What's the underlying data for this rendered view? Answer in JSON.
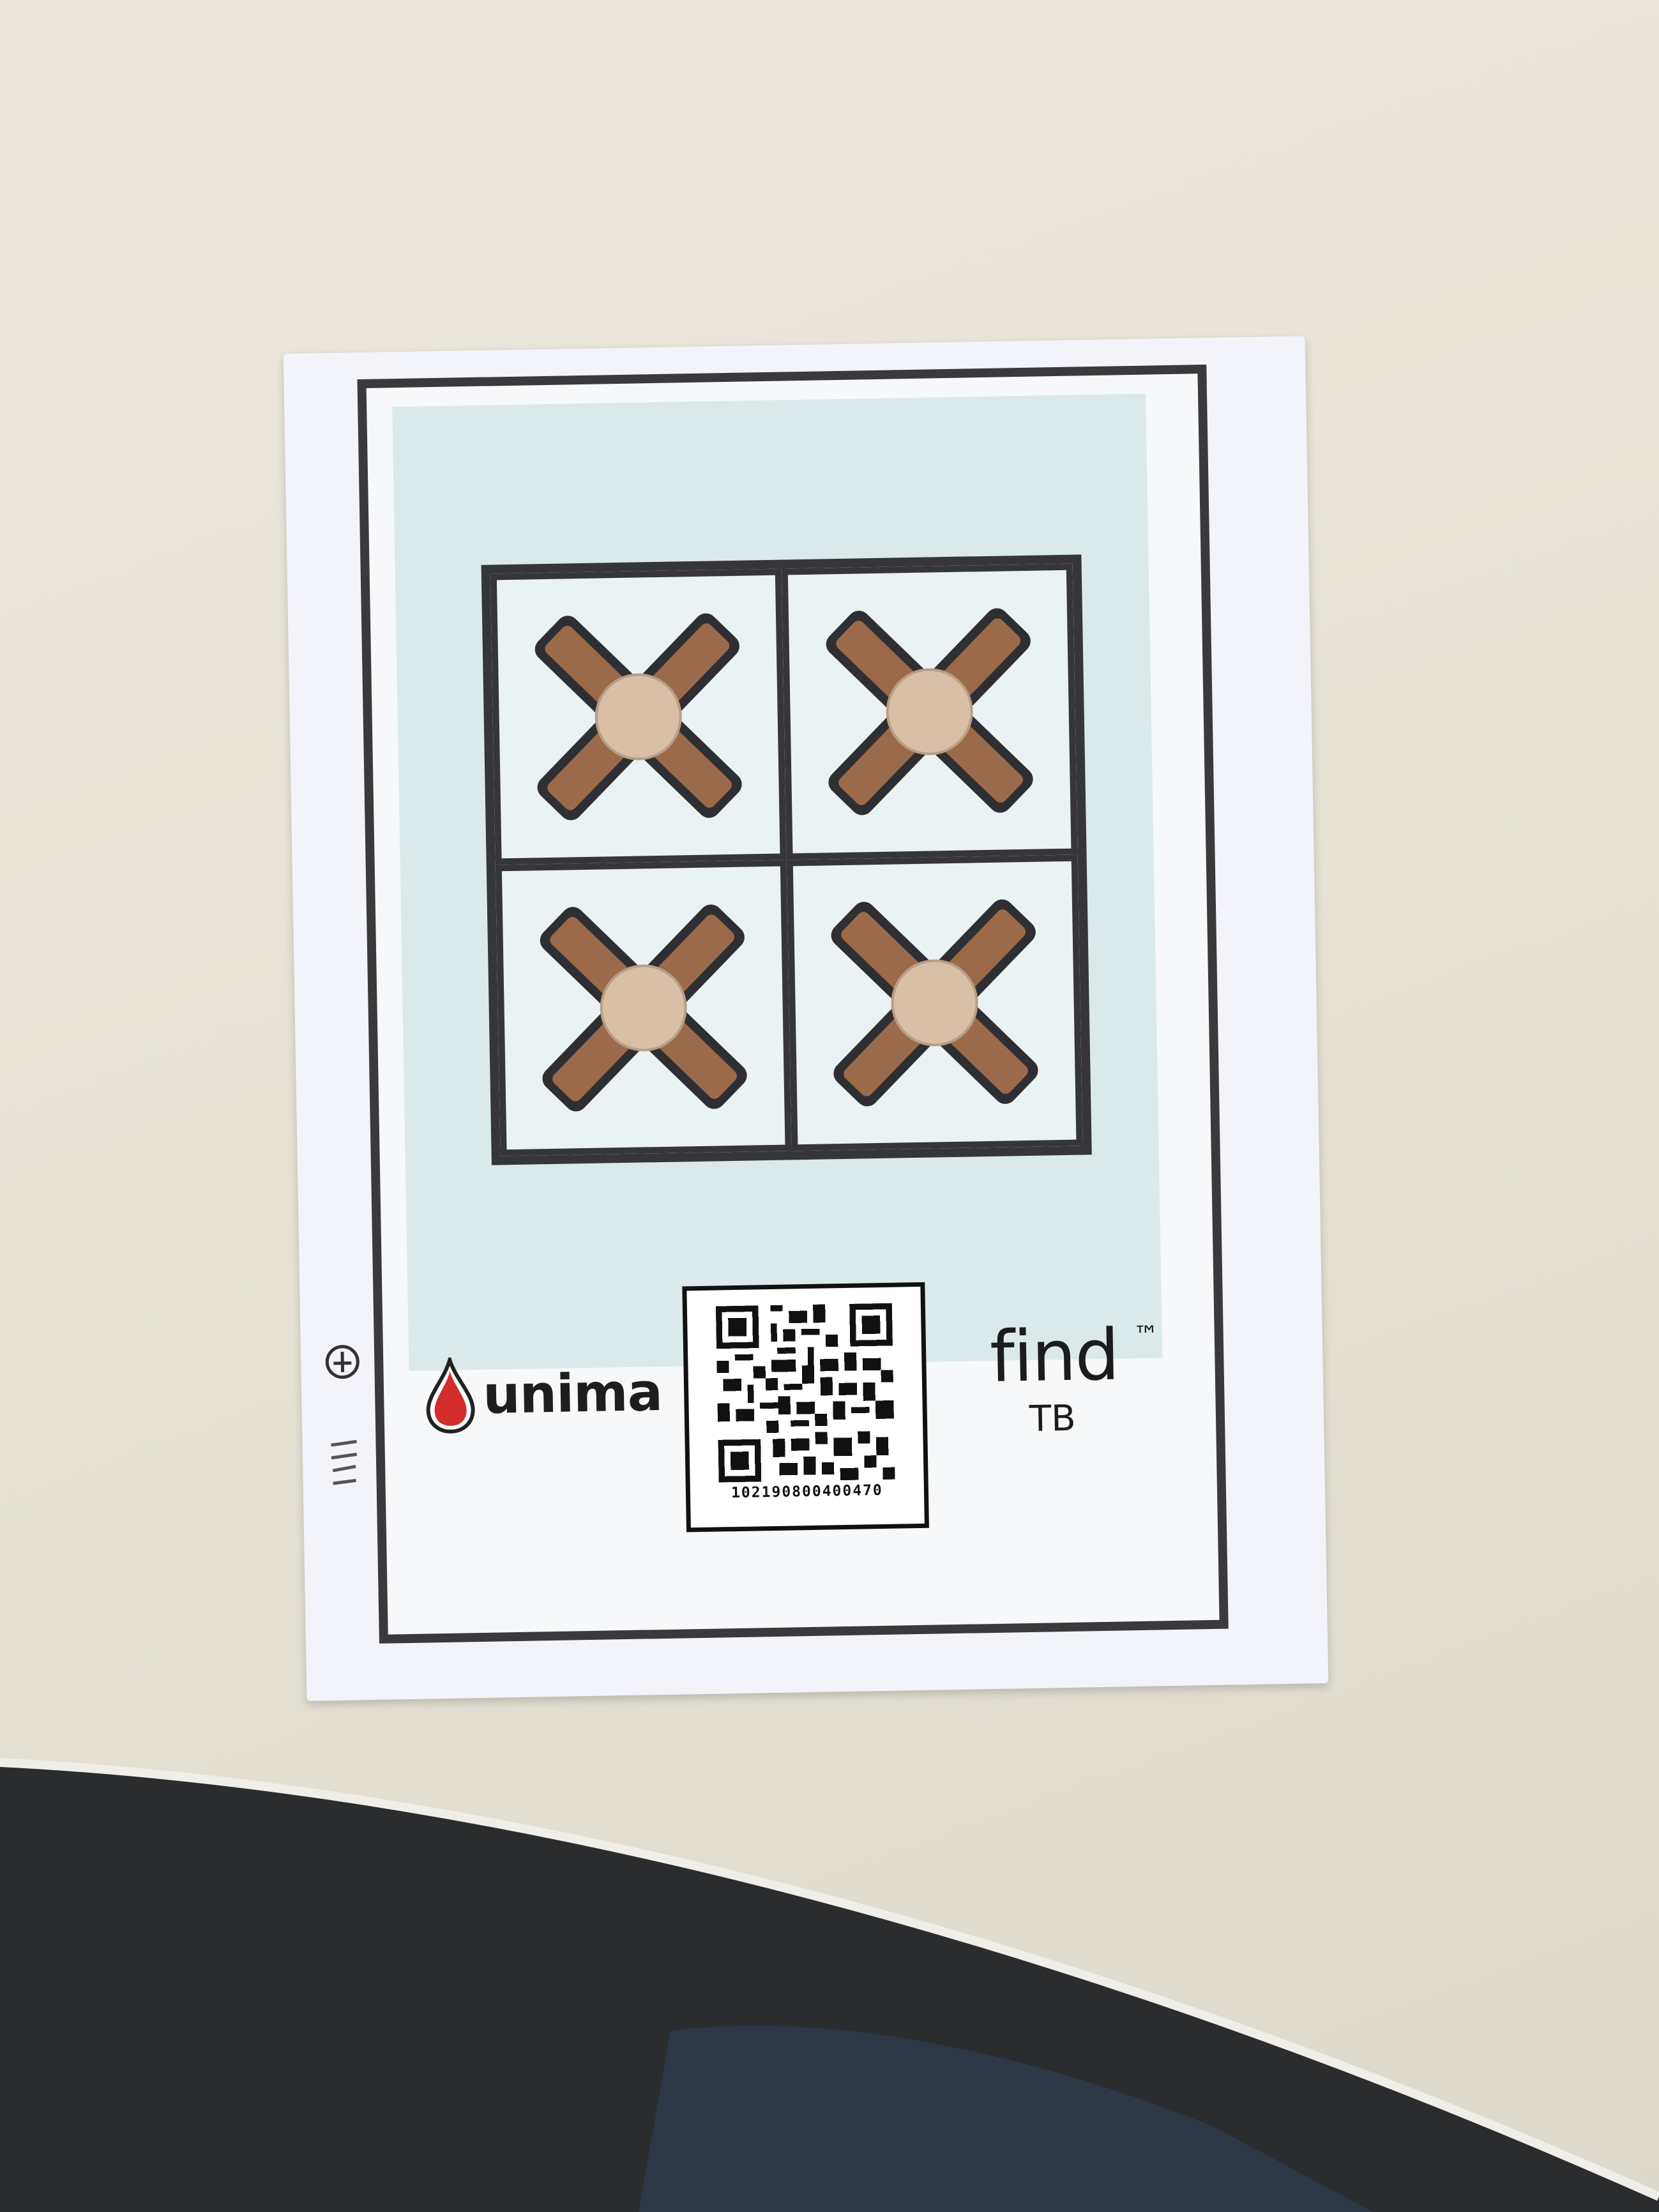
{
  "card": {
    "brand_left": "unima",
    "brand_right": "find",
    "brand_right_mark": "™",
    "brand_right_sub": "TB",
    "qr_code_number": "102190800400470",
    "well_count": 4
  },
  "icons": {
    "brand_left_logo": "blood-drop-icon",
    "code": "qr-code-icon",
    "well_pattern": "cross-channel-icon"
  },
  "colors": {
    "table": "#e9e5da",
    "card": "#f3f4fa",
    "frame": "#3a3a3c",
    "channel": "#9a6a4a",
    "sample_pad": "#d8bfa6",
    "drop": "#d42b2b"
  }
}
